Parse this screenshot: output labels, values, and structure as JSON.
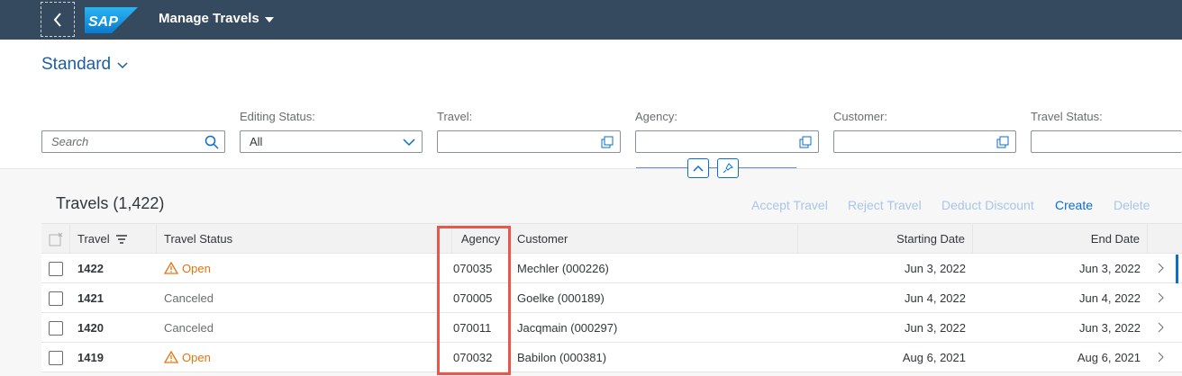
{
  "shell": {
    "app_title": "Manage Travels",
    "logo_text": "SAP"
  },
  "header": {
    "variant": "Standard"
  },
  "filters": {
    "search_placeholder": "Search",
    "editing_status_label": "Editing Status:",
    "editing_status_value": "All",
    "travel_label": "Travel:",
    "agency_label": "Agency:",
    "customer_label": "Customer:",
    "travel_status_label": "Travel Status:"
  },
  "table": {
    "title": "Travels (1,422)",
    "toolbar": {
      "accept": "Accept Travel",
      "reject": "Reject Travel",
      "deduct": "Deduct Discount",
      "create": "Create",
      "delete": "Delete"
    },
    "columns": {
      "travel": "Travel",
      "travel_status": "Travel Status",
      "agency": "Agency",
      "customer": "Customer",
      "starting_date": "Starting Date",
      "end_date": "End Date"
    },
    "rows": [
      {
        "travel": "1422",
        "status": "Open",
        "agency": "070035",
        "customer": "Mechler (000226)",
        "start": "Jun 3, 2022",
        "end": "Jun 3, 2022"
      },
      {
        "travel": "1421",
        "status": "Canceled",
        "agency": "070005",
        "customer": "Goelke (000189)",
        "start": "Jun 4, 2022",
        "end": "Jun 4, 2022"
      },
      {
        "travel": "1420",
        "status": "Canceled",
        "agency": "070011",
        "customer": "Jacqmain (000297)",
        "start": "Jun 3, 2022",
        "end": "Jun 3, 2022"
      },
      {
        "travel": "1419",
        "status": "Open",
        "agency": "070032",
        "customer": "Babilon (000381)",
        "start": "Aug 6, 2021",
        "end": "Aug 6, 2021"
      }
    ]
  },
  "colors": {
    "shell": "#354a5f",
    "accent": "#0a6ed1",
    "open": "#e9730c",
    "highlight": "#e8574a"
  }
}
